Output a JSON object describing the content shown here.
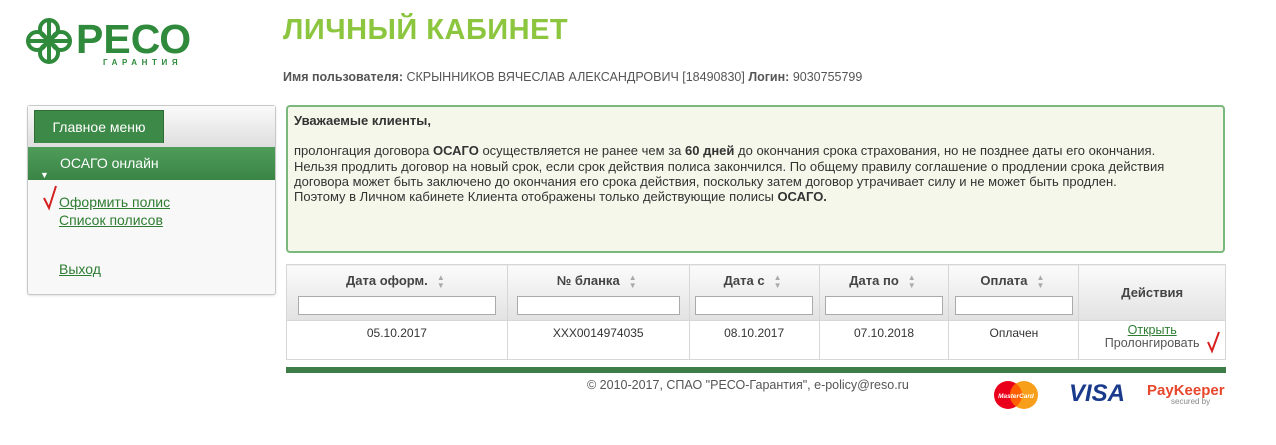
{
  "logo": {
    "word": "РЕСО",
    "sub": "ГАРАНТИЯ"
  },
  "page_title": "ЛИЧНЫЙ КАБИНЕТ",
  "user": {
    "name_label": "Имя пользователя:",
    "name_value": "СКРЫННИКОВ ВЯЧЕСЛАВ АЛЕКСАНДРОВИЧ [18490830]",
    "login_label": "Логин:",
    "login_value": "9030755799"
  },
  "sidebar": {
    "main_menu": "Главное меню",
    "section": "ОСАГО онлайн",
    "items": [
      "Оформить полис",
      "Список полисов"
    ],
    "logout": "Выход"
  },
  "notice": {
    "greeting": "Уважаемые клиенты,",
    "line1_a": "пролонгация договора ",
    "line1_b": "ОСАГО",
    "line1_c": " осуществляется не ранее чем за ",
    "line1_d": "60 дней",
    "line1_e": " до окончания срока страхования, но не позднее даты его окончания.",
    "line2": "Нельзя продлить договор на новый срок, если срок действия полиса закончился. По общему правилу соглашение о продлении срока действия договора может быть заключено до окончания его срока действия, поскольку затем договор утрачивает силу и не может быть продлен.",
    "line3_a": "Поэтому в Личном кабинете Клиента отображены только действующие полисы ",
    "line3_b": "ОСАГО."
  },
  "table": {
    "headers": [
      "Дата оформ.",
      "№ бланка",
      "Дата с",
      "Дата по",
      "Оплата",
      "Действия"
    ],
    "rows": [
      {
        "date_issued": "05.10.2017",
        "blank": "XXX0014974035",
        "date_from": "08.10.2017",
        "date_to": "07.10.2018",
        "payment": "Оплачен",
        "action_open": "Открыть",
        "action_extend": "Пролонгировать"
      }
    ]
  },
  "footer": {
    "copyright": "© 2010-2017, СПАО \"РЕСО-Гарантия\", e-policy@reso.ru",
    "mastercard": "MasterCard",
    "visa": "VISA",
    "paykeeper": "PayKeeper",
    "paykeeper_sub": "secured by"
  },
  "colors": {
    "brand_green": "#2f8a3c",
    "title_green": "#8cc63f",
    "menu_green": "#3d8a48",
    "notice_border": "#7ab87e",
    "check_red": "#d62020"
  }
}
